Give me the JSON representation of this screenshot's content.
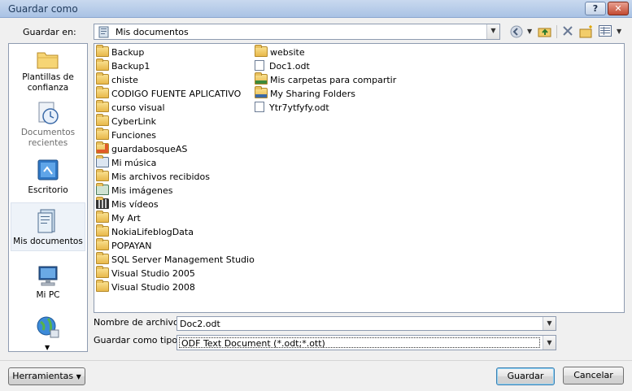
{
  "window": {
    "title": "Guardar como",
    "help_label": "?",
    "close_label": "✕"
  },
  "save_in": {
    "label": "Guardar en:",
    "value": "Mis documentos",
    "dropdown_arrow": "▼"
  },
  "toolbar": {
    "back_icon": "◀",
    "up_icon": "⬆",
    "delete_icon": "✕",
    "new_folder_icon": "📁",
    "views_icon": "▦"
  },
  "places": [
    {
      "label": "Plantillas de confianza",
      "icon": "folder-icon",
      "enabled": true
    },
    {
      "label": "Documentos recientes",
      "icon": "recent-clock-icon",
      "enabled": false
    },
    {
      "label": "Escritorio",
      "icon": "desktop-icon",
      "enabled": true
    },
    {
      "label": "Mis documentos",
      "icon": "my-documents-icon",
      "enabled": true,
      "selected": true
    },
    {
      "label": "Mi PC",
      "icon": "computer-icon",
      "enabled": true
    },
    {
      "label": "",
      "icon": "network-globe-icon",
      "enabled": true
    }
  ],
  "files_col1": [
    {
      "name": "Backup",
      "type": "folder"
    },
    {
      "name": "Backup1",
      "type": "folder"
    },
    {
      "name": "chiste",
      "type": "folder"
    },
    {
      "name": "CODIGO FUENTE APLICATIVO",
      "type": "folder"
    },
    {
      "name": "curso visual",
      "type": "folder"
    },
    {
      "name": "CyberLink",
      "type": "folder"
    },
    {
      "name": "Funciones",
      "type": "folder"
    },
    {
      "name": "guardabosqueAS",
      "type": "folder-special"
    },
    {
      "name": "Mi música",
      "type": "folder-music"
    },
    {
      "name": "Mis archivos recibidos",
      "type": "folder"
    },
    {
      "name": "Mis imágenes",
      "type": "folder-pictures"
    },
    {
      "name": "Mis vídeos",
      "type": "folder-videos"
    },
    {
      "name": "My Art",
      "type": "folder"
    },
    {
      "name": "NokiaLifeblogData",
      "type": "folder"
    },
    {
      "name": "POPAYAN",
      "type": "folder"
    },
    {
      "name": "SQL Server Management Studio",
      "type": "folder"
    },
    {
      "name": "Visual Studio 2005",
      "type": "folder"
    },
    {
      "name": "Visual Studio 2008",
      "type": "folder"
    }
  ],
  "files_col2": [
    {
      "name": "website",
      "type": "folder"
    },
    {
      "name": "Doc1.odt",
      "type": "document"
    },
    {
      "name": "Mis carpetas para compartir",
      "type": "folder-shared"
    },
    {
      "name": "My Sharing Folders",
      "type": "folder-shared"
    },
    {
      "name": "Ytr7ytfyfy.odt",
      "type": "document"
    }
  ],
  "filename": {
    "label": "Nombre de archivo:",
    "value": "Doc2.odt"
  },
  "filetype": {
    "label": "Guardar como tipo:",
    "value": "ODF Text Document (*.odt;*.ott)"
  },
  "buttons": {
    "tools": "Herramientas",
    "save": "Guardar",
    "cancel": "Cancelar"
  }
}
